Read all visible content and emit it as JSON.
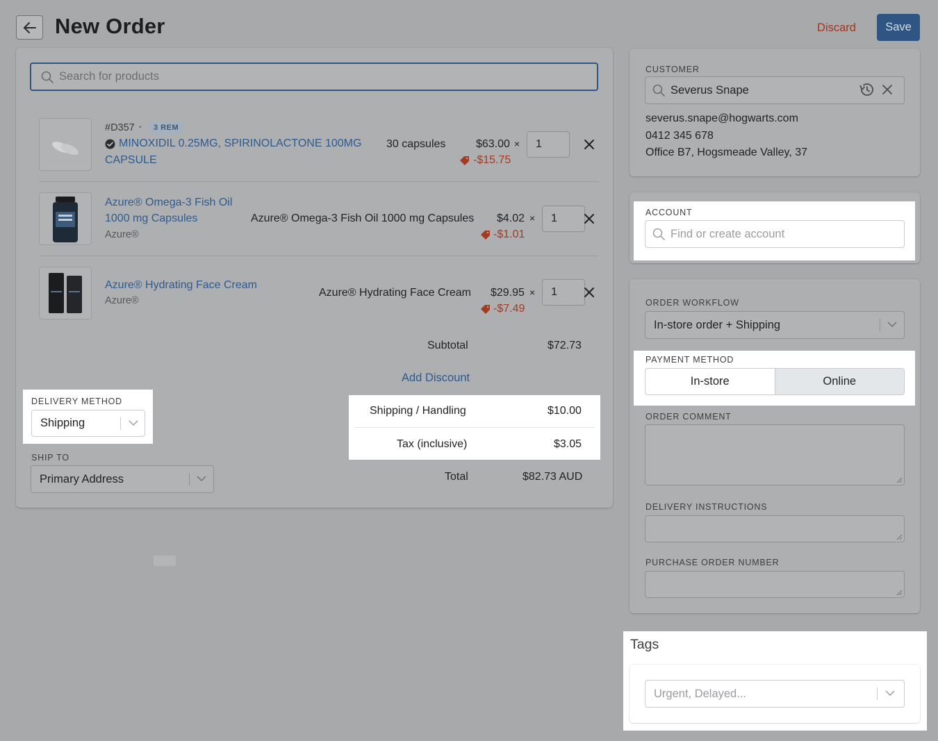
{
  "header": {
    "title": "New Order",
    "discard_label": "Discard",
    "save_label": "Save"
  },
  "search": {
    "placeholder": "Search for products"
  },
  "line_items": [
    {
      "sku": "#D357",
      "badge": "3 REM",
      "name_line1": "MINOXIDIL 0.25MG, SPIRINOLACTONE 100MG",
      "name_line2": "CAPSULE",
      "variant": "30 capsules",
      "price": "$63.00",
      "discount": "-$15.75",
      "qty": "1"
    },
    {
      "name_line1": "Azure® Omega-3 Fish Oil",
      "name_line2": "1000 mg Capsules",
      "brand": "Azure®",
      "variant": "Azure® Omega-3 Fish Oil 1000 mg Capsules",
      "price": "$4.02",
      "discount": "-$1.01",
      "qty": "1"
    },
    {
      "name_line1": "Azure® Hydrating Face Cream",
      "brand": "Azure®",
      "variant": "Azure® Hydrating Face Cream",
      "price": "$29.95",
      "discount": "-$7.49",
      "qty": "1"
    }
  ],
  "totals": {
    "subtotal_label": "Subtotal",
    "subtotal": "$72.73",
    "add_discount": "Add Discount",
    "shipping_label": "Shipping / Handling",
    "shipping": "$10.00",
    "tax_label": "Tax (inclusive)",
    "tax": "$3.05",
    "total_label": "Total",
    "total": "$82.73 AUD"
  },
  "delivery": {
    "label": "DELIVERY METHOD",
    "value": "Shipping"
  },
  "ship_to": {
    "label": "SHIP TO",
    "value": "Primary Address"
  },
  "customer": {
    "label": "CUSTOMER",
    "name": "Severus Snape",
    "email": "severus.snape@hogwarts.com",
    "phone": "0412 345 678",
    "address": "Office B7, Hogsmeade Valley, 37"
  },
  "account": {
    "label": "ACCOUNT",
    "placeholder": "Find or create account"
  },
  "order_workflow": {
    "label": "ORDER WORKFLOW",
    "value": "In-store order + Shipping"
  },
  "payment_method": {
    "label": "PAYMENT METHOD",
    "options": [
      "In-store",
      "Online"
    ],
    "selected": "Online"
  },
  "order_comment": {
    "label": "ORDER COMMENT"
  },
  "delivery_instructions": {
    "label": "DELIVERY INSTRUCTIONS"
  },
  "purchase_order": {
    "label": "PURCHASE ORDER NUMBER"
  },
  "tags": {
    "title": "Tags",
    "placeholder": "Urgent, Delayed..."
  },
  "colors": {
    "primary": "#2f5582",
    "danger": "#a3341f",
    "link": "#2e5a8e",
    "overlay": "#a8a9ab"
  }
}
